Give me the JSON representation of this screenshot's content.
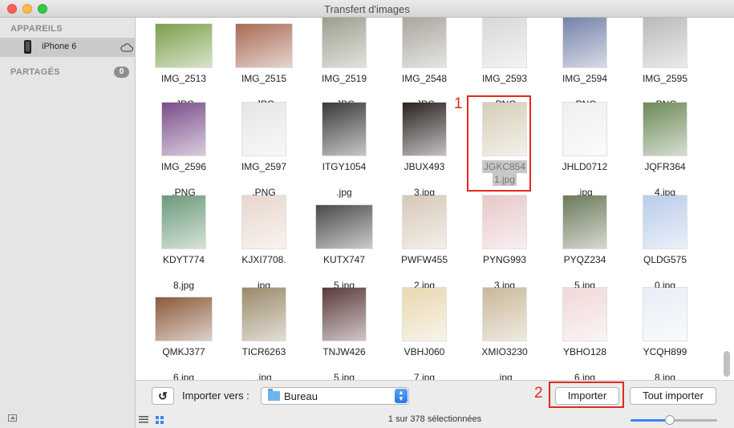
{
  "window": {
    "title": "Transfert d'images"
  },
  "sidebar": {
    "devices_header": "APPAREILS",
    "device_name": "iPhone 6",
    "shared_header": "PARTAGÉS",
    "shared_count": "0"
  },
  "tiles": [
    {
      "l1": "IMG_2513",
      "l2": ".JPG",
      "c": "#7a9f4a"
    },
    {
      "l1": "IMG_2515",
      "l2": ".JPG",
      "c": "#a86a55"
    },
    {
      "l1": "IMG_2519",
      "l2": ".JPG",
      "c": "#9a9a8a"
    },
    {
      "l1": "IMG_2548",
      "l2": ".JPG",
      "c": "#a7a39a"
    },
    {
      "l1": "IMG_2593",
      "l2": ".PNG",
      "c": "#d6d6d6"
    },
    {
      "l1": "IMG_2594",
      "l2": ".PNG",
      "c": "#6f7ea6"
    },
    {
      "l1": "IMG_2595",
      "l2": ".PNG",
      "c": "#b7b7b7"
    },
    {
      "l1": "IMG_2596",
      "l2": ".PNG",
      "c": "#7a4e8a"
    },
    {
      "l1": "IMG_2597",
      "l2": ".PNG",
      "c": "#e6e6e6"
    },
    {
      "l1": "ITGY1054",
      "l2": ".jpg",
      "c": "#3a3a3a"
    },
    {
      "l1": "JBUX493",
      "l2": "3.jpg",
      "c": "#2a2220"
    },
    {
      "l1": "JGKC854",
      "l2": "1.jpg",
      "c": "#d7cdb8",
      "sel": true
    },
    {
      "l1": "JHLD0712",
      "l2": ".jpg",
      "c": "#f0f0f0"
    },
    {
      "l1": "JQFR364",
      "l2": "4.jpg",
      "c": "#6d8a5a"
    },
    {
      "l1": "KDYT774",
      "l2": "8.jpg",
      "c": "#6b9a7a"
    },
    {
      "l1": "KJXI7708.",
      "l2": "jpg",
      "c": "#e8d6cc"
    },
    {
      "l1": "KUTX747",
      "l2": "5.jpg",
      "c": "#4a4a48"
    },
    {
      "l1": "PWFW455",
      "l2": "2.jpg",
      "c": "#d6c8b8"
    },
    {
      "l1": "PYNG993",
      "l2": "3.jpg",
      "c": "#e8c8c8"
    },
    {
      "l1": "PYQZ234",
      "l2": "5.jpg",
      "c": "#6a7a5a"
    },
    {
      "l1": "QLDG575",
      "l2": "0.jpg",
      "c": "#b8cce8"
    },
    {
      "l1": "QMKJ377",
      "l2": "6.jpg",
      "c": "#8a5a3a"
    },
    {
      "l1": "TICR6263",
      "l2": ".jpg",
      "c": "#9a8a6a"
    },
    {
      "l1": "TNJW426",
      "l2": "5.jpg",
      "c": "#5a3a3a"
    },
    {
      "l1": "VBHJ060",
      "l2": "7.jpg",
      "c": "#e8d8b0"
    },
    {
      "l1": "XMIO3230",
      "l2": ".jpg",
      "c": "#c8b898"
    },
    {
      "l1": "YBHO128",
      "l2": "6.jpg",
      "c": "#f0d8d8"
    },
    {
      "l1": "YCQH899",
      "l2": "8.jpg",
      "c": "#e8eef6"
    }
  ],
  "annotations": {
    "marker1": "1",
    "marker2": "2"
  },
  "toolbar": {
    "import_to_label": "Importer vers :",
    "destination": "Bureau",
    "import_button": "Importer",
    "import_all_button": "Tout importer"
  },
  "status": {
    "selection": "1 sur 378 sélectionnées",
    "zoom_level": 0.45
  }
}
